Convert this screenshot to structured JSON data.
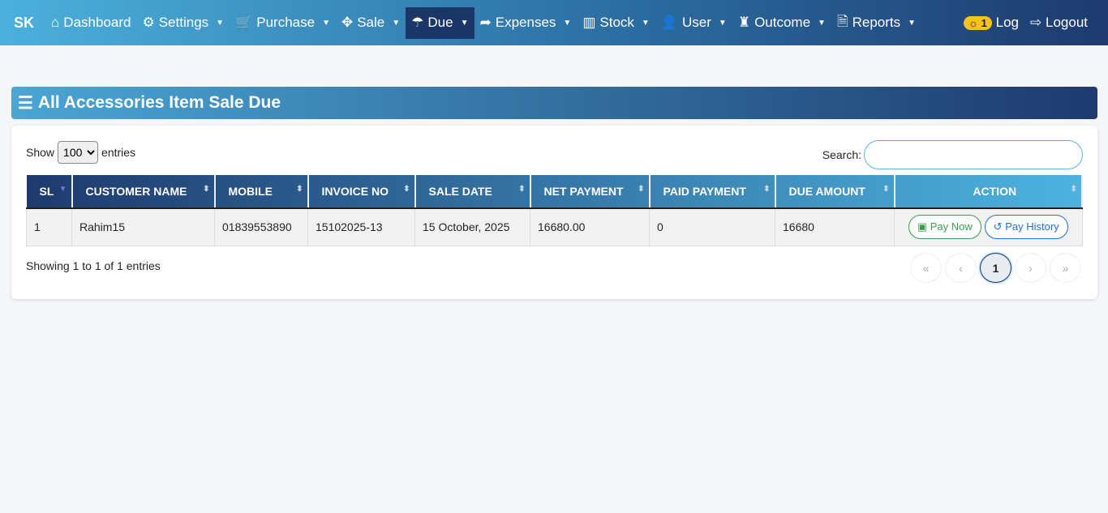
{
  "nav": {
    "brand": "SK",
    "items": [
      {
        "icon": "home-icon",
        "glyph": "⌂",
        "label": "Dashboard",
        "dd": false
      },
      {
        "icon": "gears-icon",
        "glyph": "⚙",
        "label": "Settings",
        "dd": true
      },
      {
        "icon": "cart-icon",
        "glyph": "🛒",
        "label": "Purchase",
        "dd": true
      },
      {
        "icon": "arrows-icon",
        "glyph": "✥",
        "label": "Sale",
        "dd": true
      },
      {
        "icon": "umbrella-icon",
        "glyph": "☂",
        "label": "Due",
        "dd": true
      },
      {
        "icon": "share-icon",
        "glyph": "➦",
        "label": "Expenses",
        "dd": true
      },
      {
        "icon": "chart-icon",
        "glyph": "▥",
        "label": "Stock",
        "dd": true
      },
      {
        "icon": "user-icon",
        "glyph": "👤",
        "label": "User",
        "dd": true
      },
      {
        "icon": "bag-icon",
        "glyph": "♜",
        "label": "Outcome",
        "dd": true
      },
      {
        "icon": "pdf-icon",
        "glyph": "🗎",
        "label": "Reports",
        "dd": true
      }
    ],
    "badge": "1",
    "log": "Log",
    "logout": "Logout"
  },
  "page": {
    "title": "All Accessories Item Sale Due"
  },
  "table": {
    "show": "Show",
    "entries_value": "100",
    "entries": "entries",
    "search_label": "Search:",
    "search_value": "",
    "columns": [
      "SL",
      "CUSTOMER NAME",
      "MOBILE",
      "INVOICE NO",
      "SALE DATE",
      "NET PAYMENT",
      "PAID PAYMENT",
      "DUE AMOUNT",
      "ACTION"
    ],
    "rows": [
      {
        "sl": "1",
        "name": "Rahim15",
        "mobile": "01839553890",
        "invoice": "15102025-13",
        "date": "15 October, 2025",
        "net": "16680.00",
        "paid": "0",
        "due": "16680"
      }
    ],
    "pay_now": "Pay Now",
    "pay_history": "Pay History",
    "info": "Showing 1 to 1 of 1 entries",
    "pages": [
      "«",
      "‹",
      "1",
      "›",
      "»"
    ]
  }
}
